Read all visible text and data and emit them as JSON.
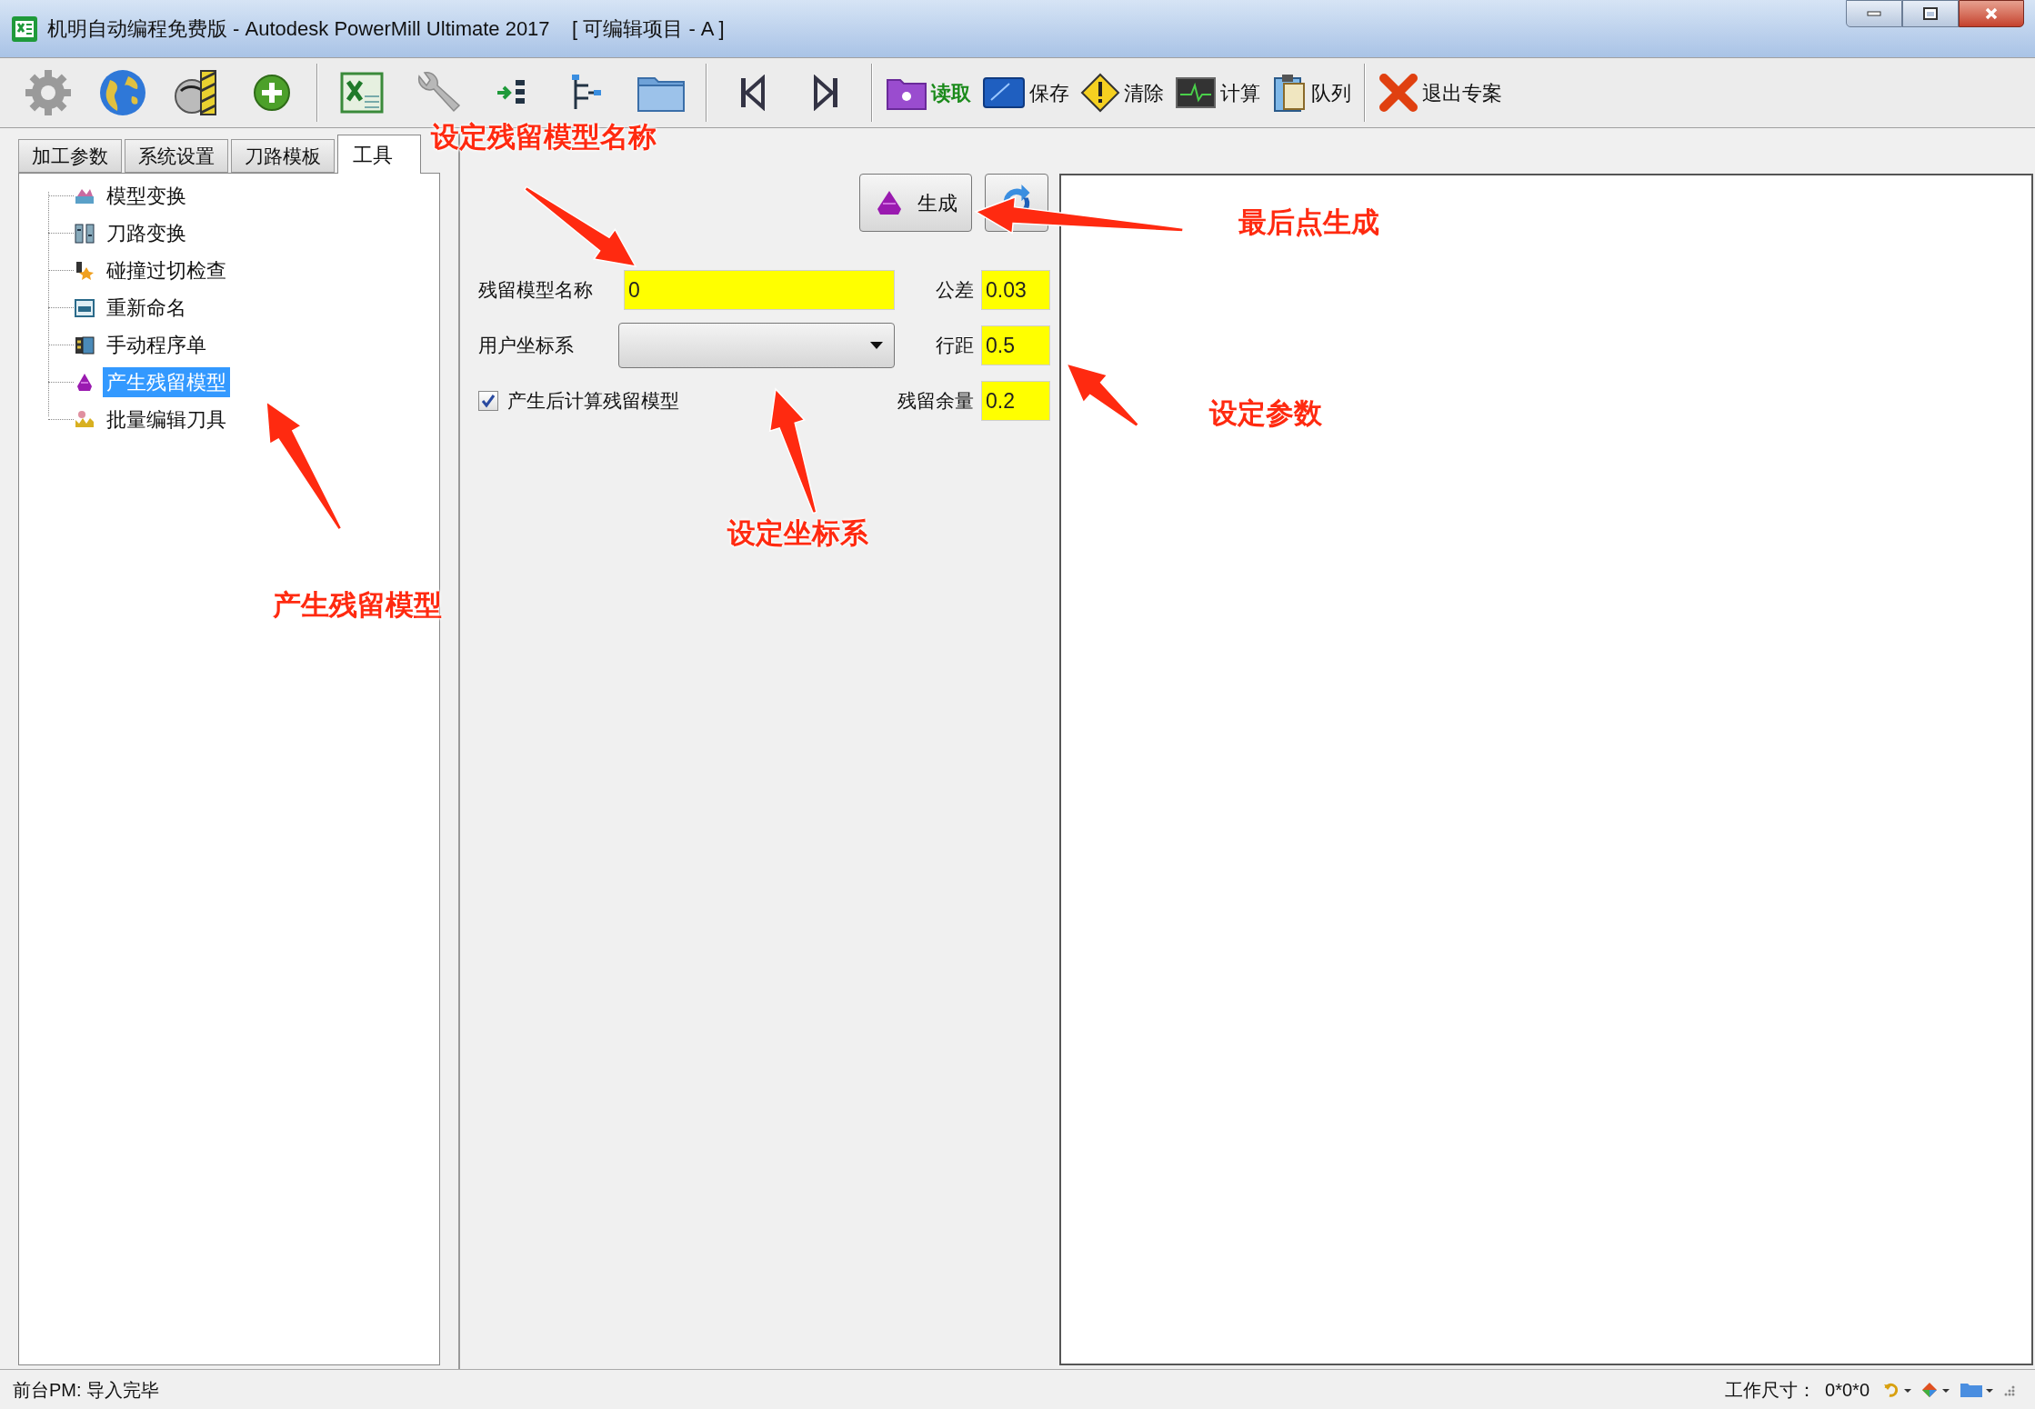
{
  "window": {
    "title": "机明自动编程免费版 - Autodesk PowerMill Ultimate 2017    [ 可编辑项目 - A ]"
  },
  "toolbar": [
    {
      "label": "读取",
      "highlight": true
    },
    {
      "label": "保存",
      "highlight": false
    },
    {
      "label": "清除",
      "highlight": false
    },
    {
      "label": "计算",
      "highlight": false
    },
    {
      "label": "队列",
      "highlight": false
    },
    {
      "label": "退出专案",
      "highlight": false
    }
  ],
  "tabs": [
    {
      "label": "加工参数",
      "selected": false
    },
    {
      "label": "系统设置",
      "selected": false
    },
    {
      "label": "刀路模板",
      "selected": false
    },
    {
      "label": "工具",
      "selected": true
    }
  ],
  "tree": [
    {
      "label": "模型变换",
      "selected": false
    },
    {
      "label": "刀路变换",
      "selected": false
    },
    {
      "label": "碰撞过切检查",
      "selected": false
    },
    {
      "label": "重新命名",
      "selected": false
    },
    {
      "label": "手动程序单",
      "selected": false
    },
    {
      "label": "产生残留模型",
      "selected": true
    },
    {
      "label": "批量编辑刀具",
      "selected": false
    }
  ],
  "form": {
    "generate_button": "生成",
    "name_label": "残留模型名称",
    "name_value": "0",
    "tolerance_label": "公差",
    "tolerance_value": "0.03",
    "ucs_label": "用户坐标系",
    "stepover_label": "行距",
    "stepover_value": "0.5",
    "checkbox": {
      "label": "产生后计算残留模型",
      "checked": true
    },
    "stock_label": "残留余量",
    "stock_value": "0.2"
  },
  "status_bar": {
    "message": "前台PM: 导入完毕",
    "size_label": "工作尺寸：",
    "size_value": "0*0*0"
  },
  "annotations": [
    {
      "text": "设定残留模型名称"
    },
    {
      "text": "最后点生成"
    },
    {
      "text": "设定参数"
    },
    {
      "text": "设定坐标系"
    },
    {
      "text": "产生残留模型"
    }
  ]
}
